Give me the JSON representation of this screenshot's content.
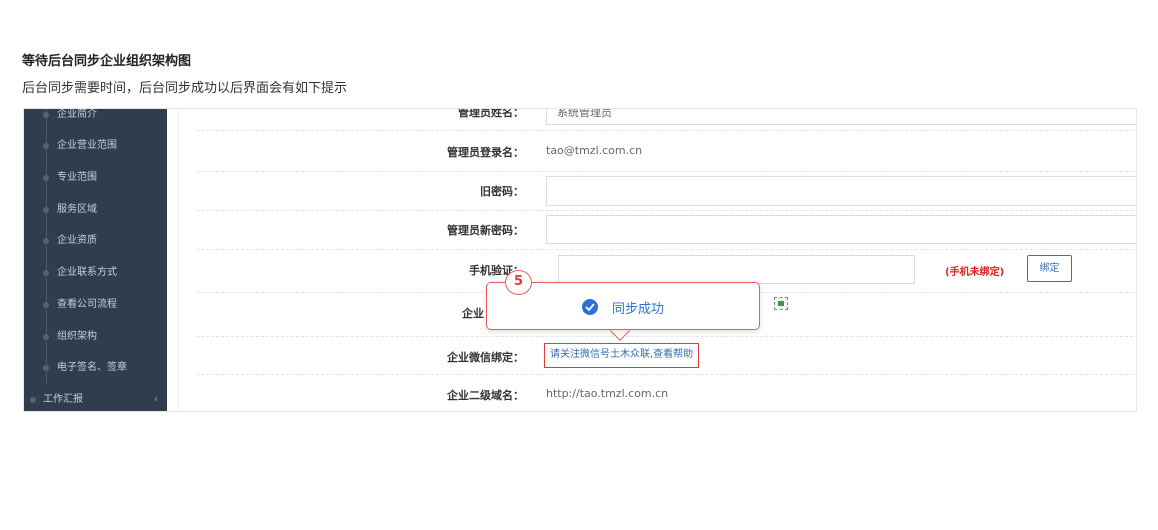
{
  "doc": {
    "title": "等待后台同步企业组织架构图",
    "description": "后台同步需要时间，后台同步成功以后界面会有如下提示"
  },
  "sidebar": {
    "items": [
      {
        "label": "企业简介"
      },
      {
        "label": "企业营业范围"
      },
      {
        "label": "专业范围"
      },
      {
        "label": "服务区域"
      },
      {
        "label": "企业资质"
      },
      {
        "label": "企业联系方式"
      },
      {
        "label": "查看公司流程"
      },
      {
        "label": "组织架构"
      },
      {
        "label": "电子签名、签章"
      }
    ],
    "bottom_item": {
      "label": "工作汇报",
      "chevron": "‹"
    }
  },
  "form": {
    "admin_name": {
      "label": "管理员姓名：",
      "value": "系统管理员"
    },
    "admin_login": {
      "label": "管理员登录名：",
      "value": "tao@tmzl.com.cn"
    },
    "old_password": {
      "label": "旧密码："
    },
    "new_password": {
      "label": "管理员新密码："
    },
    "phone_verify": {
      "label": "手机验证：",
      "warning": "(手机未绑定)",
      "bind_button": "绑定"
    },
    "enterprise_partial": {
      "label": "企业"
    },
    "wechat_bind": {
      "label": "企业微信绑定：",
      "link": "请关注微信号土木众联,查看帮助"
    },
    "subdomain": {
      "label": "企业二级域名：",
      "value": "http://tao.tmzl.com.cn"
    }
  },
  "toast": {
    "badge": "5",
    "message": "同步成功",
    "icon": "check-circle-icon",
    "color": "#2f6fd8"
  },
  "colors": {
    "sidebar_bg": "#2f3d4c",
    "highlight_red": "#e03a3a",
    "link_blue": "#2f6db5"
  }
}
